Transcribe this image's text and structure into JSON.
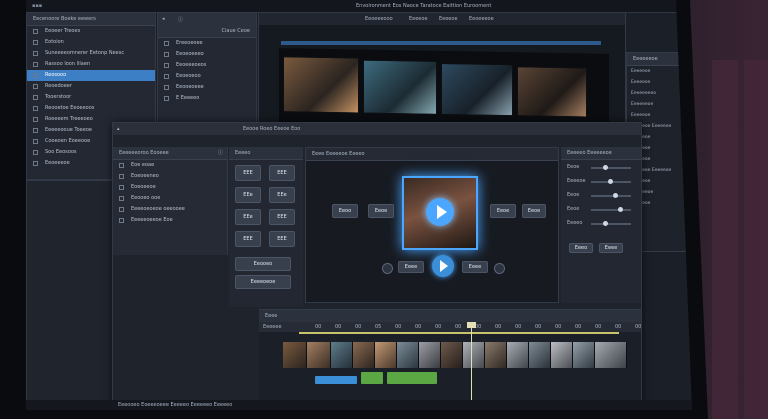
{
  "window": {
    "title": "Envoironment Eos Naoce Taratoce Eaittion Eurooment"
  },
  "browser": {
    "header": "Eecenoore Boeke eewers",
    "items": [
      {
        "label": "Eeoeer Treoes"
      },
      {
        "label": "Eotoion"
      },
      {
        "label": "Suneeeeomnerer Eetonp Neesc"
      },
      {
        "label": "Rassoo loon lilaen"
      },
      {
        "label": "Reosooo",
        "selected": true
      },
      {
        "label": "Reoedoeer"
      },
      {
        "label": "Tooerstoor"
      },
      {
        "label": "Reooetoe Eeoeeoos"
      },
      {
        "label": "Roeeeem Treeeoeo"
      },
      {
        "label": "Eeeeeooue Toeeoe"
      },
      {
        "label": "Cooeoen Eoeeooe"
      },
      {
        "label": "Soo Eeosoos"
      },
      {
        "label": "Eeoeeeoe"
      }
    ]
  },
  "media_panel": {
    "header": "Ciaue Ceoe",
    "items": [
      {
        "label": "Ereeoeoee"
      },
      {
        "label": "Eeoeoeeeo"
      },
      {
        "label": "Eeoeeeoeos"
      },
      {
        "label": "Eeoeoeoo"
      },
      {
        "label": "Eeooeoeee"
      },
      {
        "label": "E Eeeeeo"
      }
    ]
  },
  "top_preview": {
    "toolbar": [
      "Eeoeeeooo",
      "Eeeeoe",
      "Eeeeoe",
      "Eeoeeeoe",
      "Eeoeee",
      "Eeoeee"
    ]
  },
  "inner_window": {
    "title": "Eeooe  Roeo Eeeoe Eoo",
    "project_header": "Eeeeeeoroo Eooeee",
    "list": [
      {
        "label": "Eoe eoae"
      },
      {
        "label": "Eoeoeeneo"
      },
      {
        "label": "Eoeoeeoe"
      },
      {
        "label": "Eeooeo ooe"
      },
      {
        "label": "Eeeeoeoeoe oeeooee"
      },
      {
        "label": "Eeeeeoeeoe Eoe"
      }
    ],
    "effects_header": "Eeeeo",
    "effect_buttons": [
      "EEE",
      "EEE",
      "EEe",
      "EEe",
      "EEe",
      "EEE",
      "EEE",
      "EEE"
    ],
    "wide_buttons": [
      "Eeooeo",
      "Eeeeoeoe"
    ],
    "viewer_header": "Eeee  Eeeeeoe  Eeeeo",
    "viewer_buttons": [
      "Eeoo",
      "Eeoe",
      "Eeoe",
      "Eeoe"
    ],
    "transport_buttons": [
      "Eeee",
      "Eeee"
    ],
    "props_header": "Eeeeeo  Eeeeeeoe",
    "props": [
      {
        "label": "Eeoe"
      },
      {
        "label": "Eeeeoe"
      },
      {
        "label": "Eeoe"
      },
      {
        "label": "Eeoe"
      },
      {
        "label": "Eeeeo"
      }
    ],
    "props_buttons": [
      "Eeeo",
      "Eeee"
    ]
  },
  "timeline": {
    "header": "Eeee",
    "track_label": "Eeeeee",
    "ruler": [
      "00",
      "00",
      "00",
      "05",
      "00",
      "00",
      "00",
      "00",
      "00",
      "00",
      "00",
      "00",
      "00",
      "00",
      "00",
      "00",
      "00"
    ],
    "footer": "Eeeooeo Eoeeeoeee Eeeeeo Eeeeeeo Eeeeeo"
  },
  "inspector": {
    "header": "Eeeeeeoe",
    "rows": [
      {
        "label": "Eeeeeoe"
      },
      {
        "label": "Eeeeeoe"
      },
      {
        "label": "Eeeeeeeeo"
      },
      {
        "label": "Eeeeeeoe"
      },
      {
        "label": "Eeeeeoe"
      },
      {
        "label": "Eeeeeoe Eeeeeoe"
      },
      {
        "label": "Eeeeeoe"
      },
      {
        "label": "Eeeeeoe"
      },
      {
        "label": "Eeeeeoe"
      },
      {
        "label": "Eeeeeoe Eeeeeoe"
      },
      {
        "label": "Eeeeeoe"
      },
      {
        "label": "Eeeeeeoe"
      },
      {
        "label": "Eeeeeoe"
      }
    ]
  },
  "colors": {
    "accent": "#3c7fc4",
    "playhead": "#e3e0b8",
    "clip_green": "#5aa744",
    "clip_blue": "#3a8fd8",
    "glow": "#4aa6ff"
  }
}
